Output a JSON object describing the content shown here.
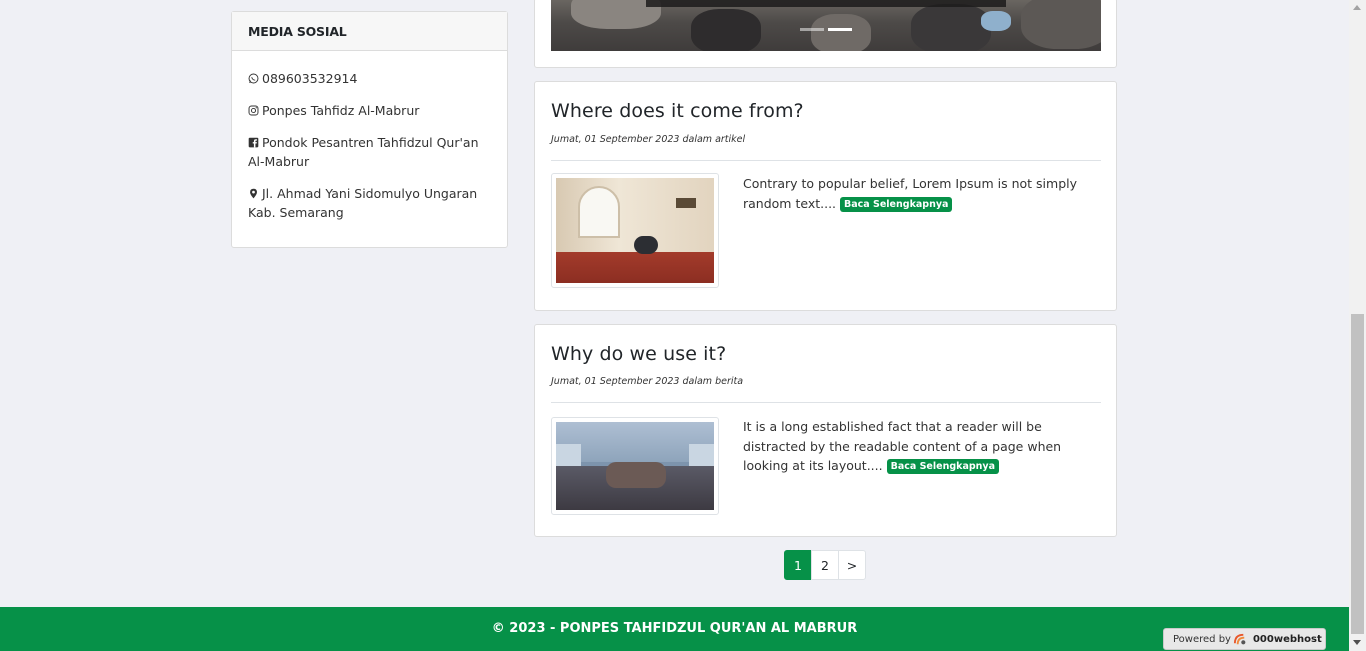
{
  "sidebar": {
    "title": "MEDIA SOSIAL",
    "items": [
      {
        "icon": "whatsapp-icon",
        "text": "089603532914"
      },
      {
        "icon": "instagram-icon",
        "text": "Ponpes Tahfidz Al-Mabrur"
      },
      {
        "icon": "facebook-icon",
        "text": "Pondok Pesantren Tahfidzul Qur'an Al-Mabrur"
      },
      {
        "icon": "map-marker-icon",
        "text": "Jl. Ahmad Yani Sidomulyo Ungaran Kab. Semarang"
      }
    ]
  },
  "carousel": {
    "active_indicator": 2,
    "indicator_count": 2
  },
  "posts": [
    {
      "title": "Where does it come from?",
      "meta": "Jumat, 01 September 2023 dalam artikel",
      "excerpt": "Contrary to popular belief, Lorem Ipsum is not simply random text....",
      "read_more": "Baca Selengkapnya"
    },
    {
      "title": "Why do we use it?",
      "meta": "Jumat, 01 September 2023 dalam berita",
      "excerpt": "It is a long established fact that a reader will be distracted by the readable content of a page when looking at its layout....",
      "read_more": "Baca Selengkapnya"
    }
  ],
  "pagination": {
    "pages": [
      "1",
      "2"
    ],
    "next": ">",
    "current": "1"
  },
  "footer": {
    "text": "© 2023 - PONPES TAHFIDZUL QUR'AN AL MABRUR"
  },
  "webhost_badge": {
    "prefix": "Powered by",
    "brand": "000webhost"
  },
  "colors": {
    "accent": "#069148",
    "page_background": "#eff0f5"
  }
}
